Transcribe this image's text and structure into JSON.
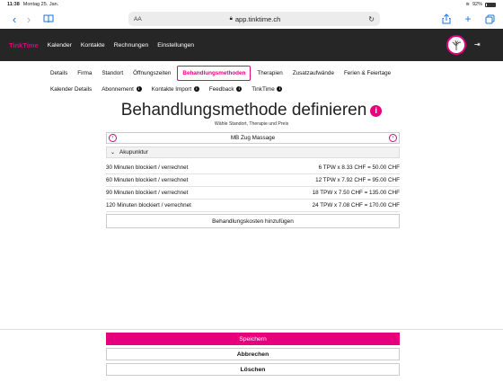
{
  "status": {
    "time": "11:38",
    "date": "Montag 25. Jan.",
    "battery": "92%"
  },
  "browser": {
    "aa": "AA",
    "url": "app.tinktime.ch"
  },
  "nav": {
    "brand": "TinkTime",
    "links": [
      "Kalender",
      "Kontakte",
      "Rechnungen",
      "Einstellungen"
    ]
  },
  "tabs1": [
    "Details",
    "Firma",
    "Standort",
    "Öffnungszeiten",
    "Behandlungsmethoden",
    "Therapien",
    "Zusatzaufwände",
    "Ferien & Feiertage"
  ],
  "tabs2": [
    "Kalender Details",
    "Abonnement",
    "Kontakte Import",
    "Feedback",
    "TinkTime"
  ],
  "page": {
    "title": "Behandlungsmethode definieren",
    "subtitle": "Wähle Standort, Therapie und Preis",
    "location": "MB Zug Massage",
    "category": "Akupunktur",
    "rows": [
      {
        "label": "30 Minuten blockiert / verrechnet",
        "price": "6 TPW x 8.33 CHF = 50.00 CHF"
      },
      {
        "label": "60 Minuten blockiert / verrechnet",
        "price": "12 TPW x 7.92 CHF = 95.00 CHF"
      },
      {
        "label": "90 Minuten blockiert / verrechnet",
        "price": "18 TPW x 7.50 CHF = 135.00 CHF"
      },
      {
        "label": "120 Minuten blockiert / verrechnet",
        "price": "24 TPW x 7.08 CHF = 170.00 CHF"
      }
    ],
    "add_label": "Behandlungskosten hinzufügen"
  },
  "actions": {
    "save": "Speichern",
    "cancel": "Abbrechen",
    "delete": "Löschen"
  },
  "colors": {
    "accent": "#e6007e",
    "navbar": "#262626"
  },
  "icons": {
    "back": "chevron-left-icon",
    "forward": "chevron-right-icon",
    "book": "book-icon",
    "reload": "reload-icon",
    "share": "share-icon",
    "plus": "plus-icon",
    "tabs": "tabs-icon",
    "avatar": "tree-avatar-icon",
    "logout": "logout-icon",
    "info": "info-icon"
  }
}
